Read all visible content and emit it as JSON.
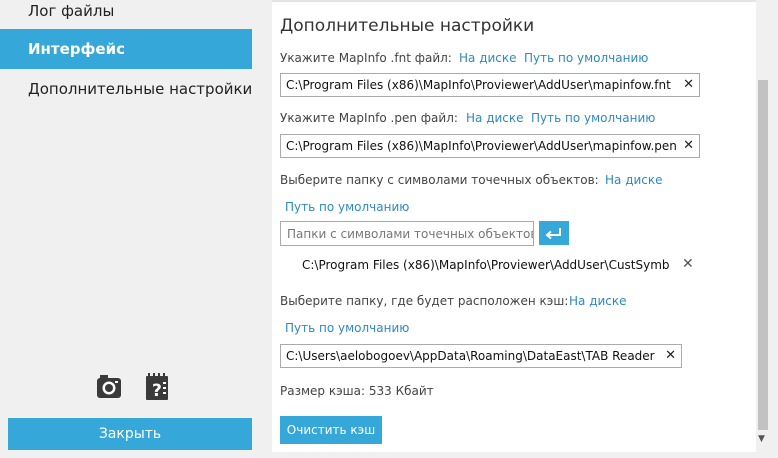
{
  "sidebar": {
    "items": [
      {
        "label": "Лог файлы"
      },
      {
        "label": "Интерфейс"
      },
      {
        "label": "Дополнительные настройки"
      }
    ],
    "close_label": "Закрыть",
    "icons": [
      "camera-icon",
      "help-book-icon"
    ]
  },
  "main": {
    "title": "Дополнительные настройки",
    "fnt": {
      "label": "Укажите MapInfo .fnt файл:",
      "on_disk": "На диске",
      "default": "Путь по умолчанию",
      "value": "C:\\Program Files (x86)\\MapInfo\\Proviewer\\AddUser\\mapinfow.fnt",
      "clear": "✕"
    },
    "pen": {
      "label": "Укажите MapInfo .pen файл:",
      "on_disk": "На диске",
      "default": "Путь по умолчанию",
      "value": "C:\\Program Files (x86)\\MapInfo\\Proviewer\\AddUser\\mapinfow.pen",
      "clear": "✕"
    },
    "symbols": {
      "label": "Выберите папку с символами точечных объектов:",
      "on_disk": "На диске",
      "default": "Путь по умолчанию",
      "placeholder": "Папки с символами точечных объектов",
      "path": "C:\\Program Files (x86)\\MapInfo\\Proviewer\\AddUser\\CustSymb",
      "remove": "✕"
    },
    "cache": {
      "label": "Выберите папку, где будет расположен кэш:",
      "on_disk": "На диске",
      "default": "Путь по умолчанию",
      "value": "C:\\Users\\aelobogoev\\AppData\\Roaming\\DataEast\\TAB Reader",
      "clear": "✕",
      "size_text": "Размер кэша: 533 Кбайт",
      "clear_button": "Очистить кэш"
    }
  },
  "colors": {
    "accent": "#35a7d9",
    "link": "#2c8ac2",
    "background": "#f0f0f0"
  }
}
